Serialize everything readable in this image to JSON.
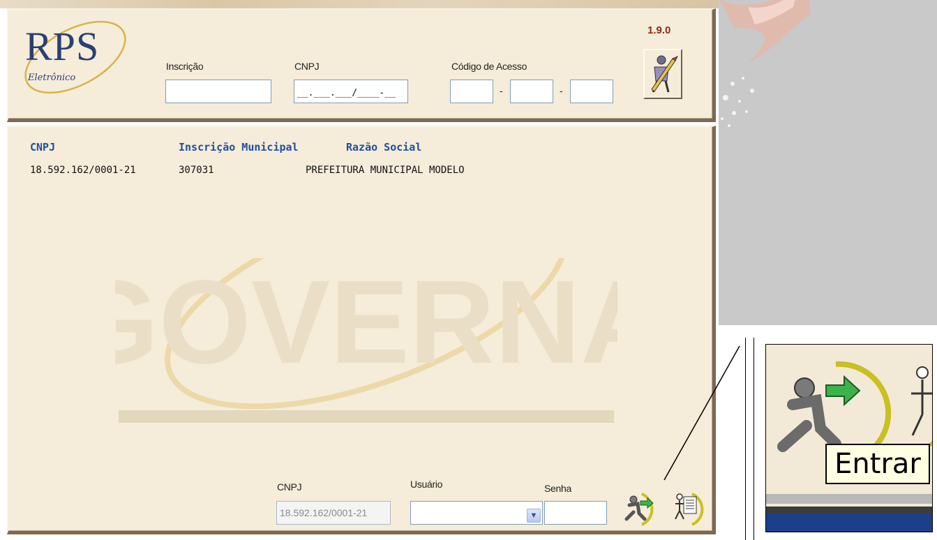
{
  "app": {
    "logo_title": "RPS",
    "logo_subtitle": "Eletrônico",
    "version": "1.9.0"
  },
  "header": {
    "inscricao_label": "Inscrição",
    "inscricao_value": "",
    "cnpj_label": "CNPJ",
    "cnpj_mask": "__.___.___/____-__",
    "codigo_label": "Código de Acesso",
    "codigo_sep1": "-",
    "codigo_sep2": "-",
    "edit_icon": "pencil-person-icon"
  },
  "table": {
    "columns": [
      "CNPJ",
      "Inscrição Municipal",
      "Razão Social"
    ],
    "rows": [
      {
        "cnpj": "18.592.162/0001-21",
        "inscricao": "307031",
        "razao": "PREFEITURA MUNICIPAL MODELO"
      }
    ]
  },
  "watermark": {
    "text": "GOVERNA"
  },
  "login": {
    "cnpj_label": "CNPJ",
    "cnpj_value": "18.592.162/0001-21",
    "usuario_label": "Usuário",
    "usuario_value": "",
    "senha_label": "Senha",
    "senha_value": "",
    "enter_icon": "enter-running-man-icon",
    "exit_icon": "exit-document-man-icon"
  },
  "zoom": {
    "tooltip": "Entrar"
  },
  "colors": {
    "panel_bg": "#f5ecd9",
    "header_text": "#1f4fa1",
    "version_text": "#8b2c12"
  }
}
